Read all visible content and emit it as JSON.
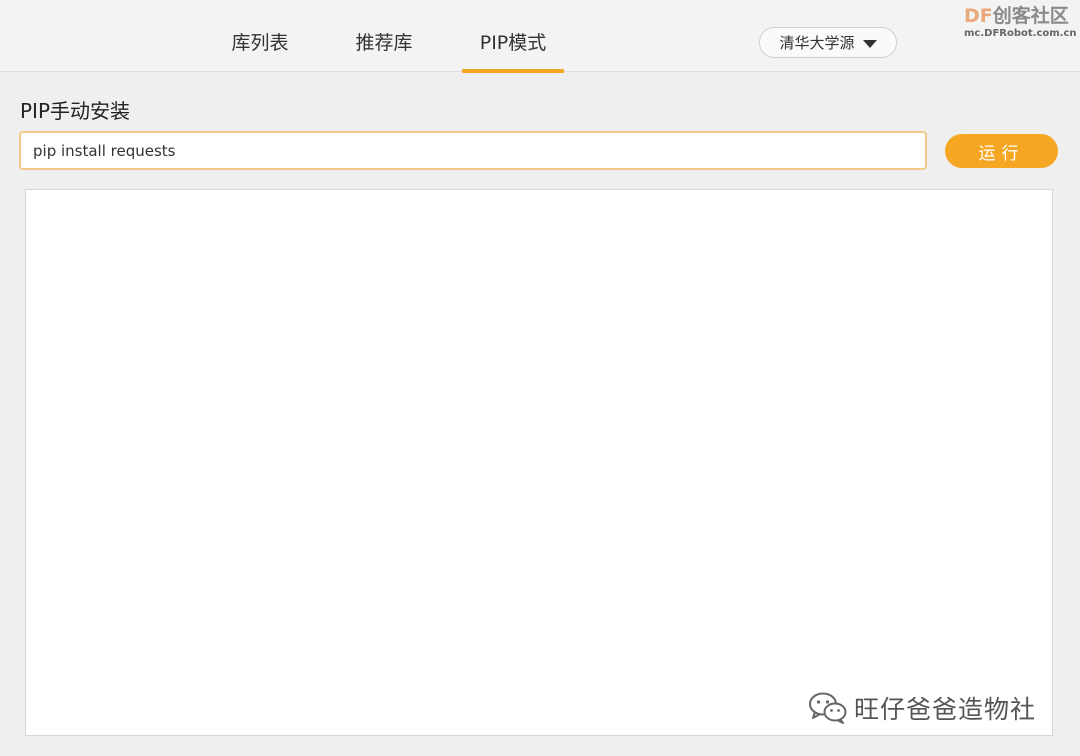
{
  "tabs": [
    {
      "label": "库列表"
    },
    {
      "label": "推荐库"
    },
    {
      "label": "PIP模式"
    }
  ],
  "active_tab": "PIP模式",
  "source_selector": {
    "value": "清华大学源"
  },
  "watermark": {
    "brand_df": "DF",
    "brand_rest": "创客社区",
    "site": "mc.DFRobot.com.cn",
    "bottom_text": "旺仔爸爸造物社"
  },
  "section": {
    "title": "PIP手动安装"
  },
  "command_input": {
    "value": "pip install requests",
    "placeholder": ""
  },
  "run_button": {
    "label": "运行"
  },
  "output": {
    "text": ""
  },
  "colors": {
    "accent": "#f5a623",
    "input_border": "#f3c98a"
  }
}
